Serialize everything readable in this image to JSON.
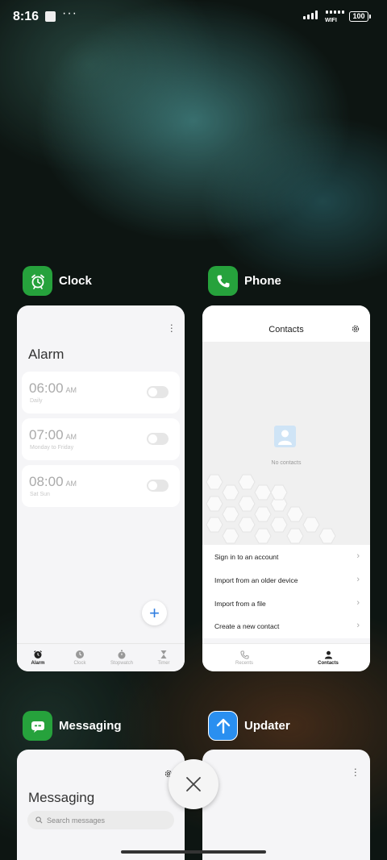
{
  "status_bar": {
    "time": "8:16",
    "more": "···",
    "wifi_label": "WIFI",
    "battery": "100"
  },
  "apps": {
    "clock": {
      "name": "Clock",
      "icon": "alarm-clock-icon",
      "color": "#26a23c",
      "screen": {
        "title": "Alarm",
        "alarms": [
          {
            "time": "06:00",
            "ampm": "AM",
            "repeat": "Daily",
            "enabled": false
          },
          {
            "time": "07:00",
            "ampm": "AM",
            "repeat": "Monday to Friday",
            "enabled": false
          },
          {
            "time": "08:00",
            "ampm": "AM",
            "repeat": "Sat Sun",
            "enabled": false
          }
        ],
        "add_symbol": "+",
        "tabs": [
          {
            "label": "Alarm",
            "icon": "alarm-icon",
            "active": true
          },
          {
            "label": "Clock",
            "icon": "clock-icon",
            "active": false
          },
          {
            "label": "Stopwatch",
            "icon": "stopwatch-icon",
            "active": false
          },
          {
            "label": "Timer",
            "icon": "hourglass-icon",
            "active": false
          }
        ]
      }
    },
    "phone": {
      "name": "Phone",
      "icon": "phone-icon",
      "color": "#26a23c",
      "screen": {
        "title": "Contacts",
        "empty_text": "No contacts",
        "actions": [
          "Sign in to an account",
          "Import from an older device",
          "Import from a file",
          "Create a new contact"
        ],
        "tabs": [
          {
            "label": "Recents",
            "icon": "phone-handset-icon",
            "active": false
          },
          {
            "label": "Contacts",
            "icon": "person-icon",
            "active": true
          }
        ]
      }
    },
    "messaging": {
      "name": "Messaging",
      "icon": "chat-bubble-icon",
      "color": "#26a23c",
      "screen": {
        "title": "Messaging",
        "search_placeholder": "Search messages"
      }
    },
    "updater": {
      "name": "Updater",
      "icon": "up-arrow-icon",
      "color": "#2a8ff0"
    }
  },
  "colors": {
    "accent_blue": "#2f7de0",
    "app_green": "#26a23c"
  }
}
